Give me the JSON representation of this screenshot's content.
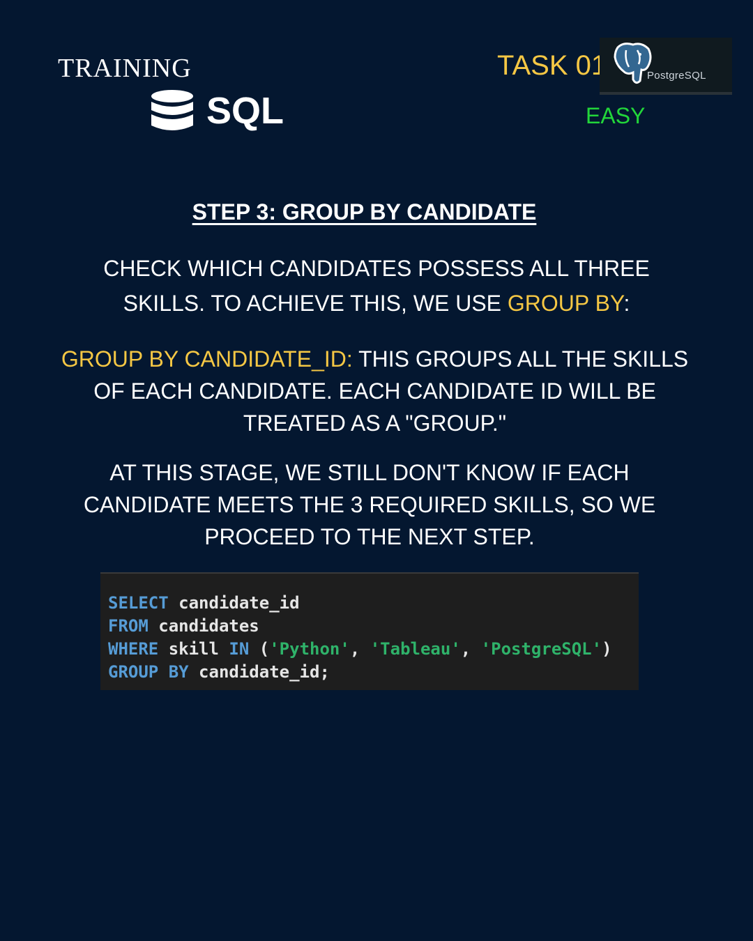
{
  "header": {
    "training": "TRAINING",
    "sql_logo_text": "SQL",
    "task": "TASK 01",
    "postgres_logo_text": "PostgreSQL",
    "difficulty": "EASY"
  },
  "step_title": "STEP 3: GROUP BY CANDIDATE",
  "paragraph1": {
    "part1": "CHECK WHICH CANDIDATES POSSESS ALL THREE SKILLS. TO ACHIEVE THIS, WE USE ",
    "highlight": "GROUP BY",
    "part2": ":"
  },
  "paragraph2": {
    "highlight": "GROUP BY CANDIDATE_ID:",
    "text": " THIS GROUPS ALL THE SKILLS OF EACH CANDIDATE. EACH CANDIDATE ID WILL BE TREATED AS A \"GROUP.\""
  },
  "paragraph3": "AT THIS STAGE, WE STILL DON'T KNOW IF EACH CANDIDATE MEETS THE 3 REQUIRED SKILLS, SO WE PROCEED TO THE NEXT STEP.",
  "code": {
    "select_kw": "SELECT",
    "select_col": " candidate_id",
    "from_kw": "FROM",
    "from_table": " candidates",
    "where_kw": "WHERE",
    "where_col": " skill ",
    "in_kw": "IN",
    "open_paren": " (",
    "val1": "'Python'",
    "sep1": ", ",
    "val2": "'Tableau'",
    "sep2": ", ",
    "val3": "'PostgreSQL'",
    "close_paren": ")",
    "group_kw": "GROUP",
    "by_kw": "BY",
    "group_col": " candidate_id;"
  },
  "colors": {
    "background": "#041730",
    "highlight": "#f5c744",
    "easy": "#22d63a",
    "keyword": "#569cd6",
    "string": "#2fb36a"
  }
}
